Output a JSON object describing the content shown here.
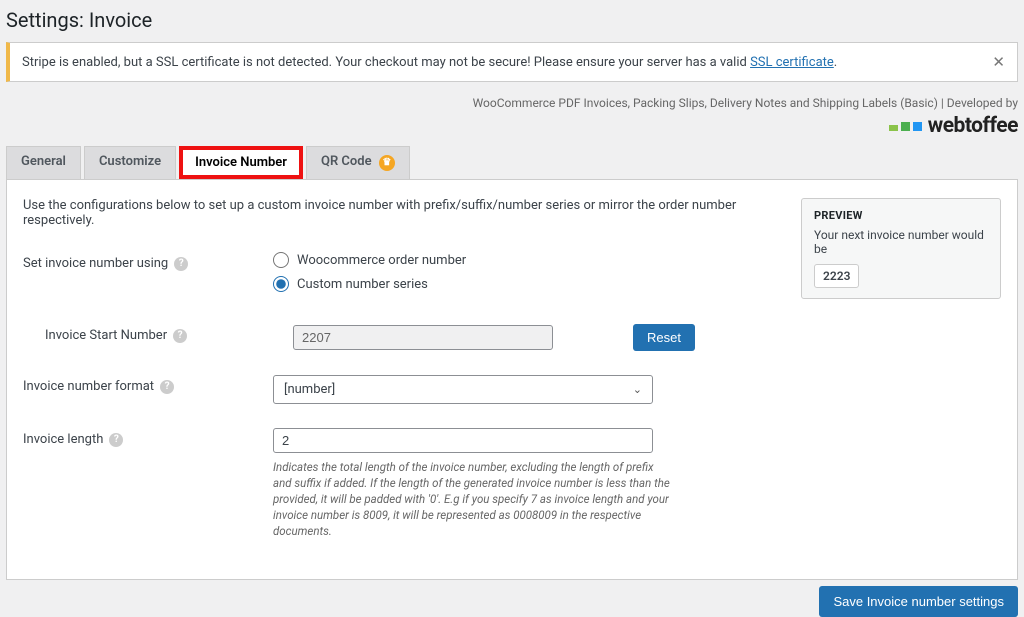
{
  "page_title": "Settings: Invoice",
  "notice": {
    "text_prefix": "Stripe is enabled, but a SSL certificate is not detected. Your checkout may not be secure! Please ensure your server has a valid ",
    "link_text": "SSL certificate",
    "suffix": "."
  },
  "dev_info": "WooCommerce PDF Invoices, Packing Slips, Delivery Notes and Shipping Labels (Basic) | Developed by",
  "logo_text": "webtoffee",
  "tabs": {
    "general": "General",
    "customize": "Customize",
    "invoice_number": "Invoice Number",
    "qr_code": "QR Code"
  },
  "intro": "Use the configurations below to set up a custom invoice number with prefix/suffix/number series or mirror the order number respectively.",
  "labels": {
    "set_using": "Set invoice number using",
    "start_number": "Invoice Start Number",
    "format": "Invoice number format",
    "length": "Invoice length"
  },
  "radio": {
    "woo": "Woocommerce order number",
    "custom": "Custom number series"
  },
  "values": {
    "start_number": "2207",
    "format": "[number]",
    "length": "2"
  },
  "buttons": {
    "reset": "Reset",
    "save": "Save Invoice number settings"
  },
  "help_text": "Indicates the total length of the invoice number, excluding the length of prefix and suffix if added. If the length of the generated invoice number is less than the provided, it will be padded with '0'. E.g if you specify 7 as invoice length and your invoice number is 8009, it will be represented as 0008009 in the respective documents.",
  "preview": {
    "title": "PREVIEW",
    "desc": "Your next invoice number would be",
    "value": "2223"
  }
}
